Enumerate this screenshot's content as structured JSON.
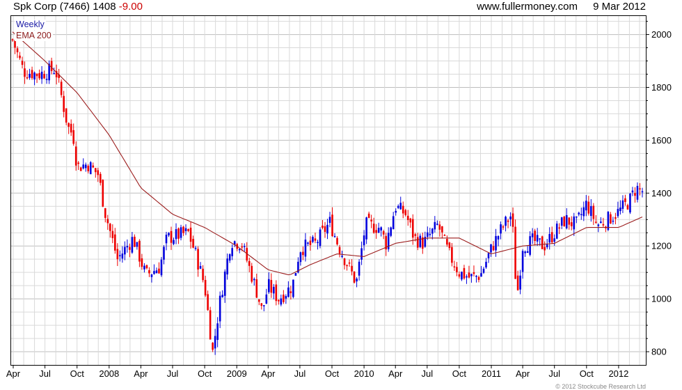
{
  "header": {
    "title": "Spk Corp (7466)",
    "last_price": "1408",
    "change": "-9.00",
    "site": "www.fullermoney.com",
    "date": "9 Mar 2012"
  },
  "legend": {
    "weekly": "Weekly",
    "ema": "EMA 200"
  },
  "footer": {
    "copyright": "© 2012 Stockcube Research Ltd"
  },
  "colors": {
    "up": "#0000dd",
    "down": "#ee0000",
    "ema": "#9b1c1c",
    "grid": "#d9d9d9"
  },
  "chart_data": {
    "type": "candlestick",
    "title": "Spk Corp (7466)",
    "interval": "weekly",
    "y_axis": {
      "side": "right",
      "ticks": [
        800,
        1000,
        1200,
        1400,
        1600,
        1800,
        2000
      ],
      "ylim": [
        750,
        2070
      ]
    },
    "x_axis": {
      "range": [
        "2007-03-26",
        "2012-03-19"
      ],
      "ticks": [
        {
          "label": "Apr",
          "date": "2007-04-01"
        },
        {
          "label": "Jul",
          "date": "2007-07-01"
        },
        {
          "label": "Oct",
          "date": "2007-10-01"
        },
        {
          "label": "2008",
          "date": "2008-01-01"
        },
        {
          "label": "Apr",
          "date": "2008-04-01"
        },
        {
          "label": "Jul",
          "date": "2008-07-01"
        },
        {
          "label": "Oct",
          "date": "2008-10-01"
        },
        {
          "label": "2009",
          "date": "2009-01-01"
        },
        {
          "label": "Apr",
          "date": "2009-04-01"
        },
        {
          "label": "Jul",
          "date": "2009-07-01"
        },
        {
          "label": "Oct",
          "date": "2009-10-01"
        },
        {
          "label": "2010",
          "date": "2010-01-01"
        },
        {
          "label": "Apr",
          "date": "2010-04-01"
        },
        {
          "label": "Jul",
          "date": "2010-07-01"
        },
        {
          "label": "Oct",
          "date": "2010-10-01"
        },
        {
          "label": "2011",
          "date": "2011-01-01"
        },
        {
          "label": "Apr",
          "date": "2011-04-01"
        },
        {
          "label": "Jul",
          "date": "2011-07-01"
        },
        {
          "label": "Oct",
          "date": "2011-10-01"
        },
        {
          "label": "2012",
          "date": "2012-01-01"
        }
      ]
    },
    "closes": [
      {
        "date": "2007-03-30",
        "v": 1980
      },
      {
        "date": "2007-05-01",
        "v": 1860
      },
      {
        "date": "2007-06-15",
        "v": 1850
      },
      {
        "date": "2007-07-31",
        "v": 1870
      },
      {
        "date": "2007-08-15",
        "v": 1780
      },
      {
        "date": "2007-09-05",
        "v": 1650
      },
      {
        "date": "2007-09-20",
        "v": 1620
      },
      {
        "date": "2007-10-01",
        "v": 1500
      },
      {
        "date": "2007-11-01",
        "v": 1510
      },
      {
        "date": "2007-12-01",
        "v": 1470
      },
      {
        "date": "2007-12-20",
        "v": 1330
      },
      {
        "date": "2008-01-25",
        "v": 1150
      },
      {
        "date": "2008-03-10",
        "v": 1230
      },
      {
        "date": "2008-04-15",
        "v": 1090
      },
      {
        "date": "2008-05-25",
        "v": 1120
      },
      {
        "date": "2008-06-15",
        "v": 1230
      },
      {
        "date": "2008-08-15",
        "v": 1250
      },
      {
        "date": "2008-09-05",
        "v": 1170
      },
      {
        "date": "2008-10-01",
        "v": 1050
      },
      {
        "date": "2008-10-24",
        "v": 800
      },
      {
        "date": "2008-11-15",
        "v": 1000
      },
      {
        "date": "2008-12-15",
        "v": 1220
      },
      {
        "date": "2009-01-15",
        "v": 1210
      },
      {
        "date": "2009-02-15",
        "v": 1080
      },
      {
        "date": "2009-03-01",
        "v": 1020
      },
      {
        "date": "2009-03-15",
        "v": 950
      },
      {
        "date": "2009-04-01",
        "v": 1050
      },
      {
        "date": "2009-05-01",
        "v": 1000
      },
      {
        "date": "2009-06-10",
        "v": 1050
      },
      {
        "date": "2009-07-01",
        "v": 1190
      },
      {
        "date": "2009-08-15",
        "v": 1210
      },
      {
        "date": "2009-09-25",
        "v": 1290
      },
      {
        "date": "2009-10-20",
        "v": 1200
      },
      {
        "date": "2009-12-10",
        "v": 1060
      },
      {
        "date": "2010-01-05",
        "v": 1280
      },
      {
        "date": "2010-02-15",
        "v": 1270
      },
      {
        "date": "2010-03-05",
        "v": 1210
      },
      {
        "date": "2010-04-01",
        "v": 1350
      },
      {
        "date": "2010-05-01",
        "v": 1320
      },
      {
        "date": "2010-05-25",
        "v": 1230
      },
      {
        "date": "2010-06-20",
        "v": 1210
      },
      {
        "date": "2010-08-01",
        "v": 1280
      },
      {
        "date": "2010-09-01",
        "v": 1170
      },
      {
        "date": "2010-10-01",
        "v": 1100
      },
      {
        "date": "2010-11-01",
        "v": 1080
      },
      {
        "date": "2010-12-01",
        "v": 1090
      },
      {
        "date": "2011-01-01",
        "v": 1190
      },
      {
        "date": "2011-02-01",
        "v": 1270
      },
      {
        "date": "2011-03-01",
        "v": 1320
      },
      {
        "date": "2011-03-15",
        "v": 1000
      },
      {
        "date": "2011-04-01",
        "v": 1200
      },
      {
        "date": "2011-05-01",
        "v": 1220
      },
      {
        "date": "2011-06-01",
        "v": 1200
      },
      {
        "date": "2011-07-01",
        "v": 1250
      },
      {
        "date": "2011-08-01",
        "v": 1300
      },
      {
        "date": "2011-09-01",
        "v": 1280
      },
      {
        "date": "2011-10-01",
        "v": 1360
      },
      {
        "date": "2011-11-01",
        "v": 1280
      },
      {
        "date": "2011-12-01",
        "v": 1300
      },
      {
        "date": "2012-01-01",
        "v": 1330
      },
      {
        "date": "2012-02-01",
        "v": 1370
      },
      {
        "date": "2012-02-20",
        "v": 1420
      },
      {
        "date": "2012-03-09",
        "v": 1408
      }
    ],
    "ema200": [
      {
        "date": "2007-03-30",
        "v": 2010
      },
      {
        "date": "2007-07-01",
        "v": 1900
      },
      {
        "date": "2007-10-01",
        "v": 1780
      },
      {
        "date": "2008-01-01",
        "v": 1620
      },
      {
        "date": "2008-04-01",
        "v": 1420
      },
      {
        "date": "2008-07-01",
        "v": 1320
      },
      {
        "date": "2008-10-01",
        "v": 1270
      },
      {
        "date": "2009-01-01",
        "v": 1200
      },
      {
        "date": "2009-04-01",
        "v": 1110
      },
      {
        "date": "2009-06-01",
        "v": 1090
      },
      {
        "date": "2009-08-01",
        "v": 1130
      },
      {
        "date": "2009-10-15",
        "v": 1170
      },
      {
        "date": "2010-01-01",
        "v": 1160
      },
      {
        "date": "2010-04-01",
        "v": 1210
      },
      {
        "date": "2010-07-01",
        "v": 1230
      },
      {
        "date": "2010-10-01",
        "v": 1230
      },
      {
        "date": "2011-01-01",
        "v": 1170
      },
      {
        "date": "2011-04-01",
        "v": 1200
      },
      {
        "date": "2011-07-01",
        "v": 1210
      },
      {
        "date": "2011-10-01",
        "v": 1270
      },
      {
        "date": "2012-01-01",
        "v": 1270
      },
      {
        "date": "2012-03-09",
        "v": 1310
      }
    ]
  }
}
